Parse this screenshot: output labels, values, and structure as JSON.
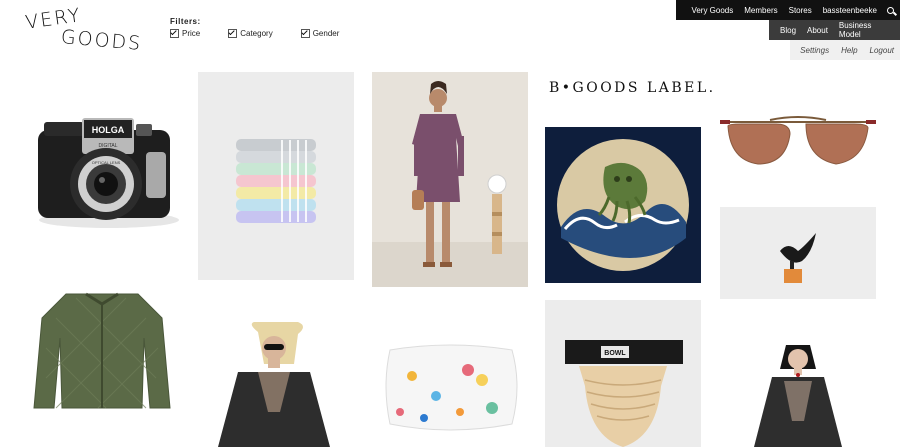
{
  "logo": {
    "line1": "VERY",
    "line2": "GOODS"
  },
  "filters": {
    "title": "Filters:",
    "options": [
      {
        "label": "Price",
        "checked": true
      },
      {
        "label": "Category",
        "checked": true
      },
      {
        "label": "Gender",
        "checked": true
      }
    ]
  },
  "nav": {
    "primary": [
      "Very Goods",
      "Members",
      "Stores",
      "bassteenbeeke"
    ],
    "secondary": [
      "Blog",
      "About",
      "Business Model"
    ],
    "utility": [
      "Settings",
      "Help",
      "Logout"
    ]
  },
  "products": {
    "camera_brand": "HOLGA",
    "camera_model": "DIGITAL",
    "camera_lens": "OPTICAL LENS",
    "label_banner": "B•GOODS LABEL.",
    "bowl_label": "BOWL"
  },
  "colors": {
    "nav_primary_bg": "#111111",
    "nav_secondary_bg": "#3b3b3b",
    "nav_utility_bg": "#f0f0f0",
    "page_bg": "#ffffff"
  }
}
